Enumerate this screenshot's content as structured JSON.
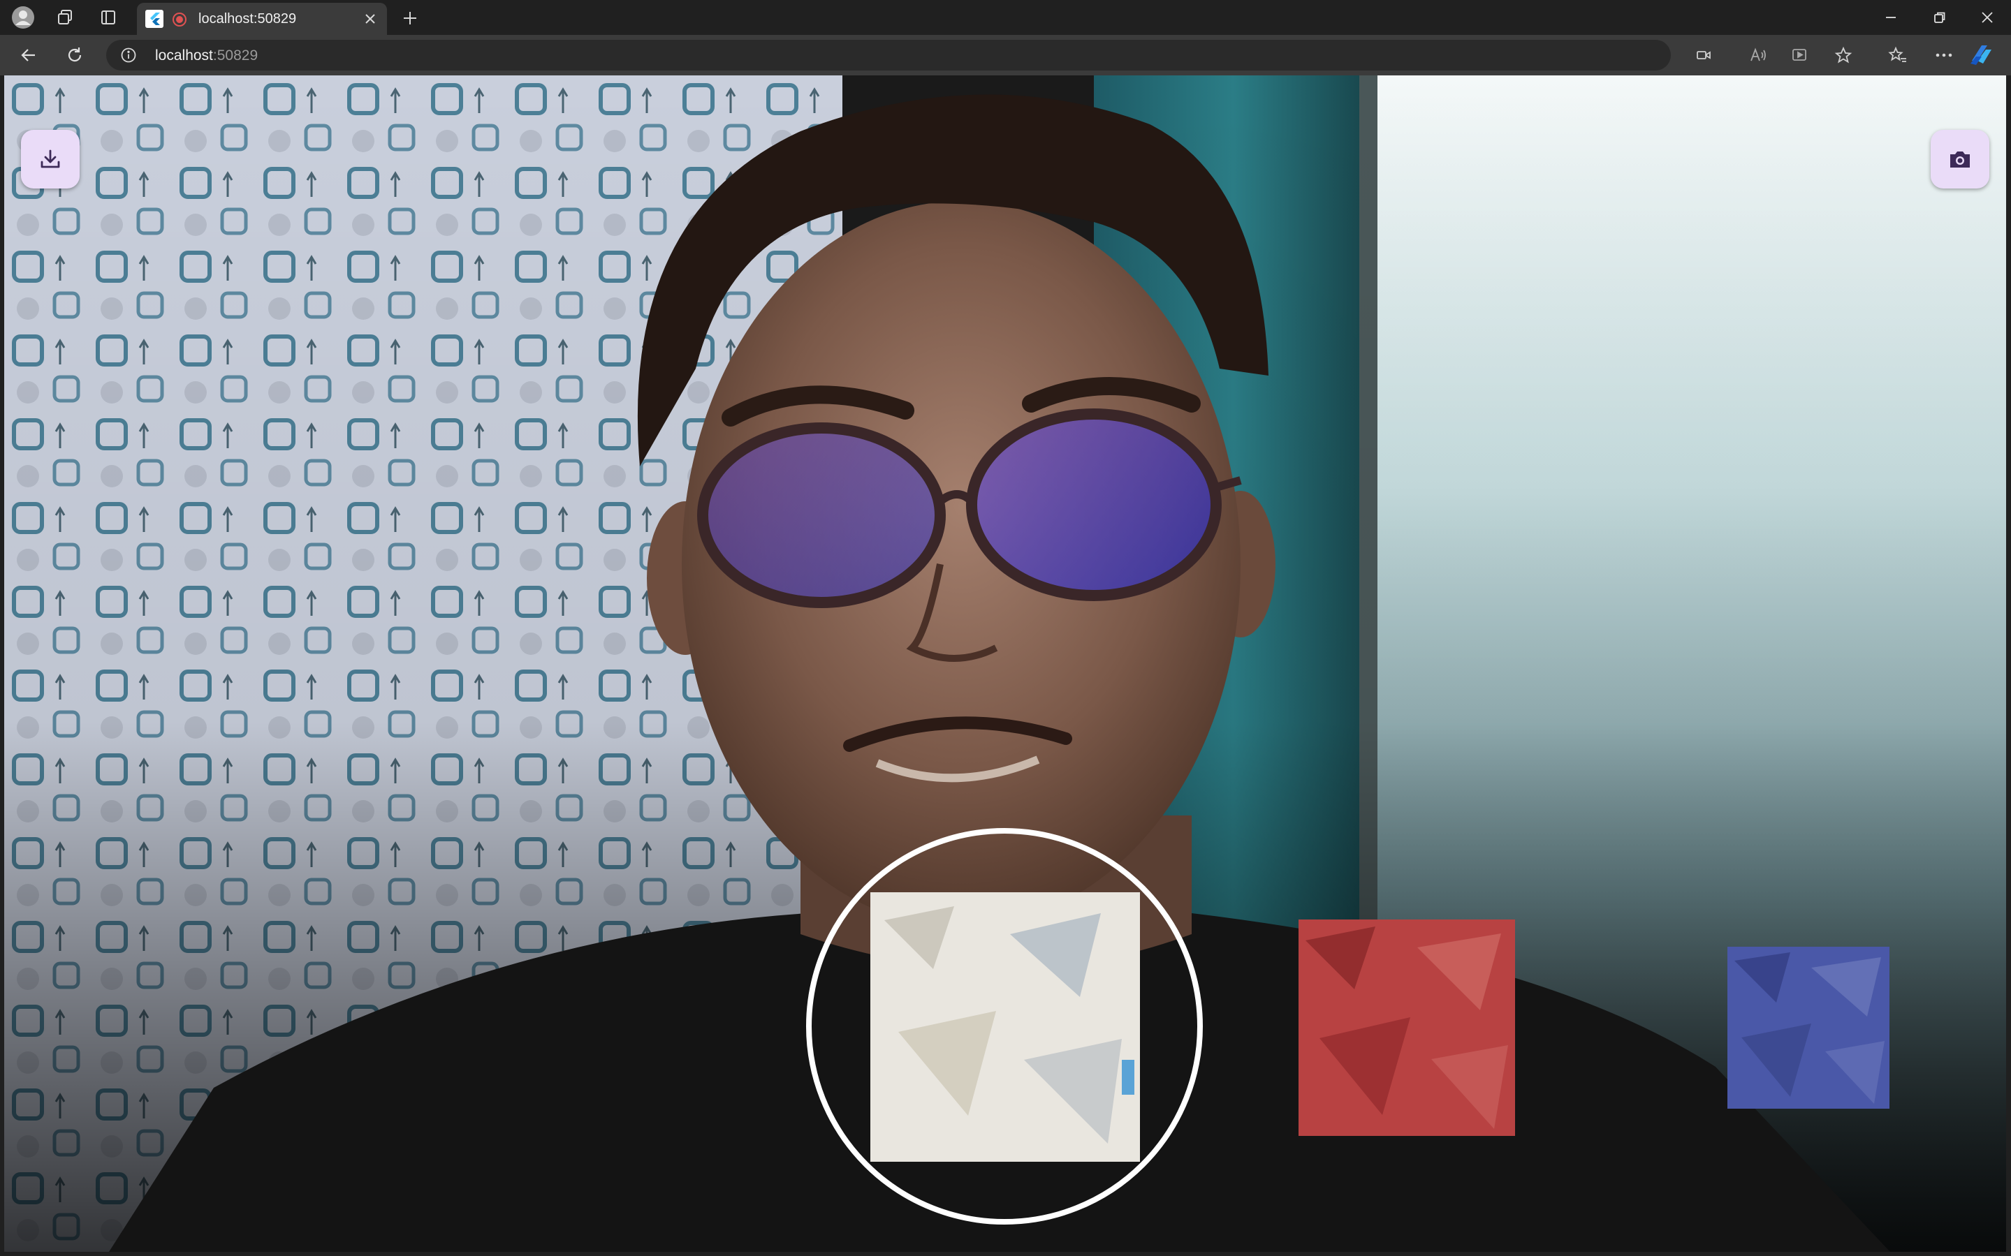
{
  "browser": {
    "tab": {
      "title": "localhost:50829"
    },
    "address_bar": {
      "host": "localhost",
      "port": ":50829"
    }
  },
  "app": {
    "download_button": {
      "icon": "download-icon"
    },
    "capture_button": {
      "icon": "camera-icon"
    },
    "filters": [
      {
        "name": "original",
        "tint": "#f2f0ea",
        "selected": true
      },
      {
        "name": "red",
        "tint": "#c23a3a",
        "selected": false
      },
      {
        "name": "blue",
        "tint": "#4a58a8",
        "selected": false
      }
    ]
  },
  "colors": {
    "fab_background": "#eadcf8",
    "fab_icon": "#3d2a58",
    "chrome_dark": "#202020",
    "chrome_toolbar": "#3b3b3b"
  }
}
